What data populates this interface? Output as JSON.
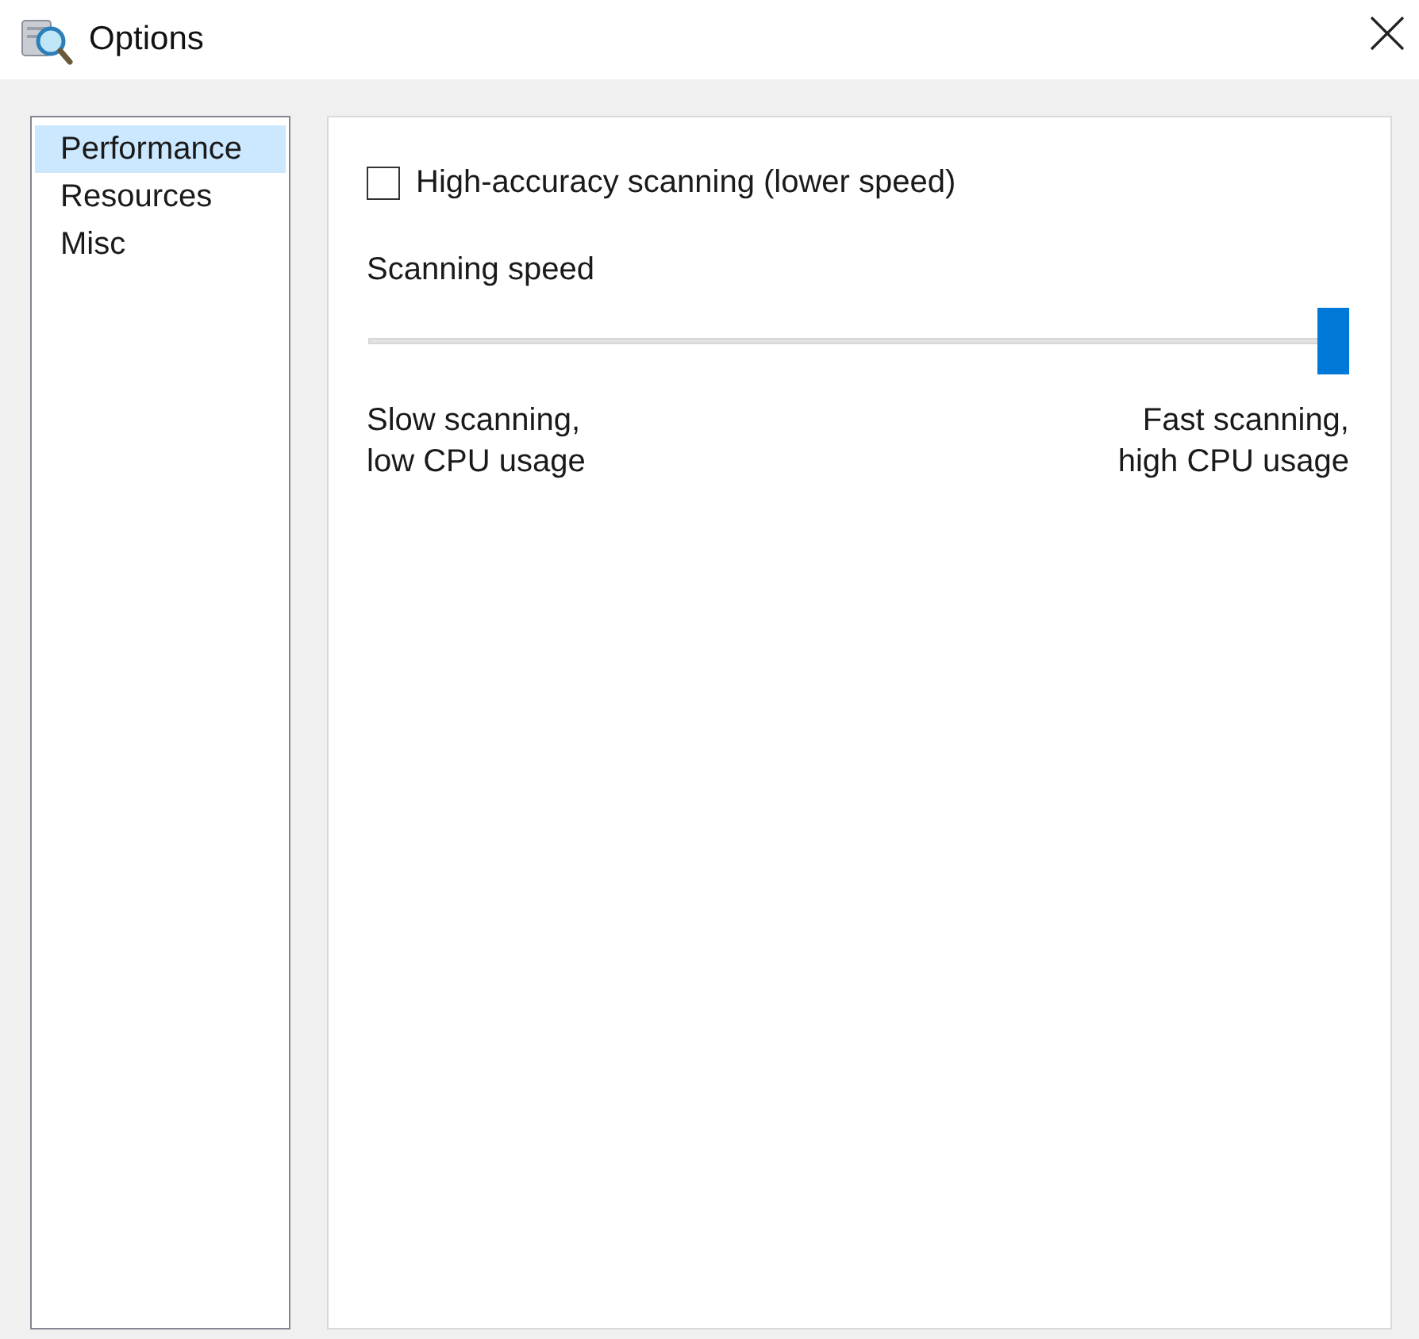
{
  "window": {
    "title": "Options"
  },
  "sidebar": {
    "items": [
      {
        "label": "Performance",
        "selected": true
      },
      {
        "label": "Resources",
        "selected": false
      },
      {
        "label": "Misc",
        "selected": false
      }
    ]
  },
  "panel": {
    "checkbox": {
      "label": "High-accuracy scanning (lower speed)",
      "checked": false
    },
    "slider": {
      "label": "Scanning speed",
      "level": 1,
      "min_label": "Slow scanning,\nlow CPU usage",
      "max_label": "Fast scanning,\nhigh CPU usage"
    }
  }
}
